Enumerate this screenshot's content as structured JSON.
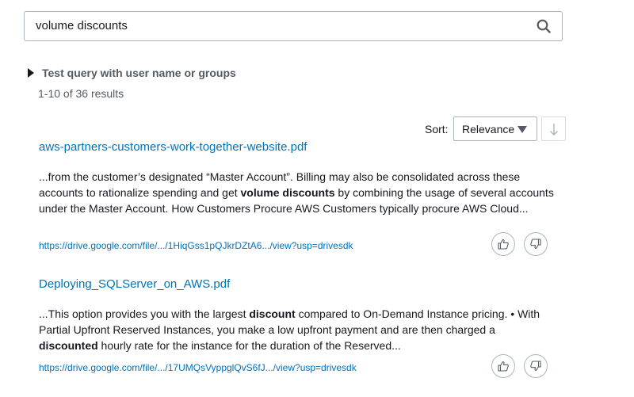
{
  "search": {
    "value": "volume discounts",
    "icon": "search-icon"
  },
  "test_query": {
    "label": "Test query with user name or groups",
    "icon": "caret-right-icon"
  },
  "results_count": "1-10 of 36 results",
  "sort": {
    "label": "Sort:",
    "selected": "Relevance",
    "order_icon": "arrow-down-icon"
  },
  "results": [
    {
      "title": "aws-partners-customers-work-together-website.pdf",
      "excerpt": [
        {
          "text": "...from the customer’s designated “Master Account”. Billing may also be consolidated across these accounts to rationalize spending and get ",
          "bold": false
        },
        {
          "text": "volume discounts",
          "bold": true
        },
        {
          "text": " by combining the usage of several accounts under the Master Account. How Customers Procure AWS Customers typically procure AWS Cloud...",
          "bold": false
        }
      ],
      "url": "https://drive.google.com/file/.../1HiqGss1pQJkrDZtA6.../view?usp=drivesdk"
    },
    {
      "title": "Deploying_SQLServer_on_AWS.pdf",
      "excerpt": [
        {
          "text": "...This option provides you with the largest ",
          "bold": false
        },
        {
          "text": "discount",
          "bold": true
        },
        {
          "text": " compared to On-Demand Instance pricing. • With Partial Upfront Reserved Instances, you make a low upfront payment and are then charged a ",
          "bold": false
        },
        {
          "text": "discounted",
          "bold": true
        },
        {
          "text": " hourly rate for the instance for the duration of the Reserved...",
          "bold": false
        }
      ],
      "url": "https://drive.google.com/file/.../17UMQsVyppglQvS6fJ.../view?usp=drivesdk"
    }
  ],
  "feedback_icons": [
    "thumbs-up-icon",
    "thumbs-down-icon"
  ],
  "colors": {
    "link": "#0073bb",
    "text": "#16191f",
    "muted": "#545b64",
    "border": "#aab7b8"
  }
}
